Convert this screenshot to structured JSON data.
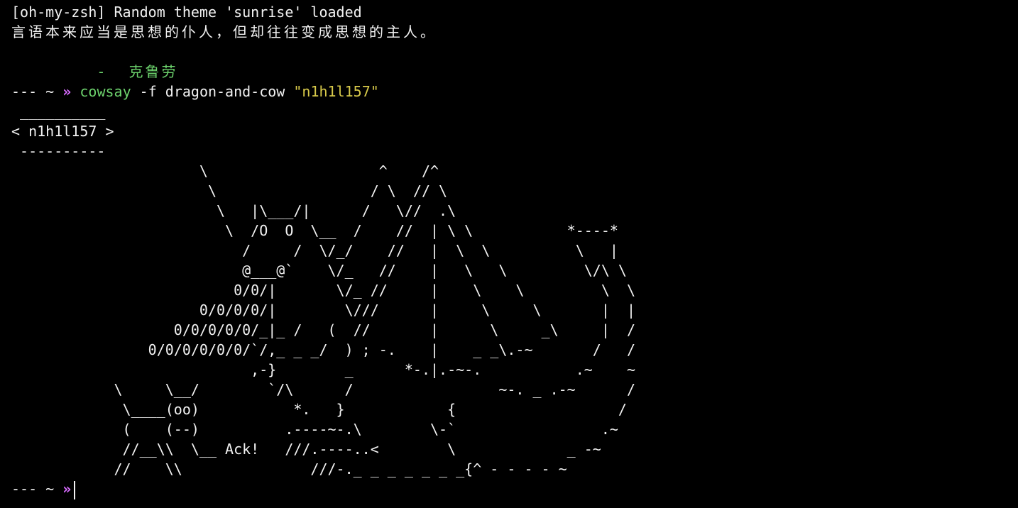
{
  "colors": {
    "background": "#000000",
    "text": "#f2f2f2",
    "green": "#6dd36d",
    "prompt_arrow": "#d86bff",
    "string_yellow": "#d7c94a"
  },
  "terminal": {
    "theme_message": "[oh-my-zsh] Random theme 'sunrise' loaded",
    "quote": "言语本来应当是思想的仆人，但却往往变成思想的主人。",
    "author": "        -  克鲁劳",
    "prompt": {
      "dashes": "---",
      "tilde": "~",
      "arrow": "»"
    },
    "command": {
      "name": "cowsay",
      "args": " -f dragon-and-cow ",
      "string": "\"n1h1l157\""
    },
    "output": " __________\n< n1h1l157 >\n ----------\n                      \\                    ^    /^\n                       \\                  / \\  // \\\n                        \\   |\\___/|      /   \\//  .\\\n                         \\  /O  O  \\__  /    //  | \\ \\           *----*\n                           /     /  \\/_/    //   |  \\  \\          \\   |\n                           @___@`    \\/_   //    |   \\   \\         \\/\\ \\\n                          0/0/|       \\/_ //     |    \\    \\         \\  \\\n                      0/0/0/0/|        \\///      |     \\     \\       |  |\n                   0/0/0/0/0/_|_ /   (  //       |      \\     _\\     |  /\n                0/0/0/0/0/0/`/,_ _ _/  ) ; -.    |    _ _\\.-~       /   /\n                            ,-}        _      *-.|.-~-.           .~    ~\n            \\     \\__/        `/\\      /                 ~-. _ .-~      /\n             \\____(oo)           *.   }            {                   /\n             (    (--)          .----~-.\\        \\-`                 .~\n             //__\\\\  \\__ Ack!   ///.----..<        \\             _ -~\n            //    \\\\               ///-._ _ _ _ _ _ _{^ - - - - ~"
  }
}
